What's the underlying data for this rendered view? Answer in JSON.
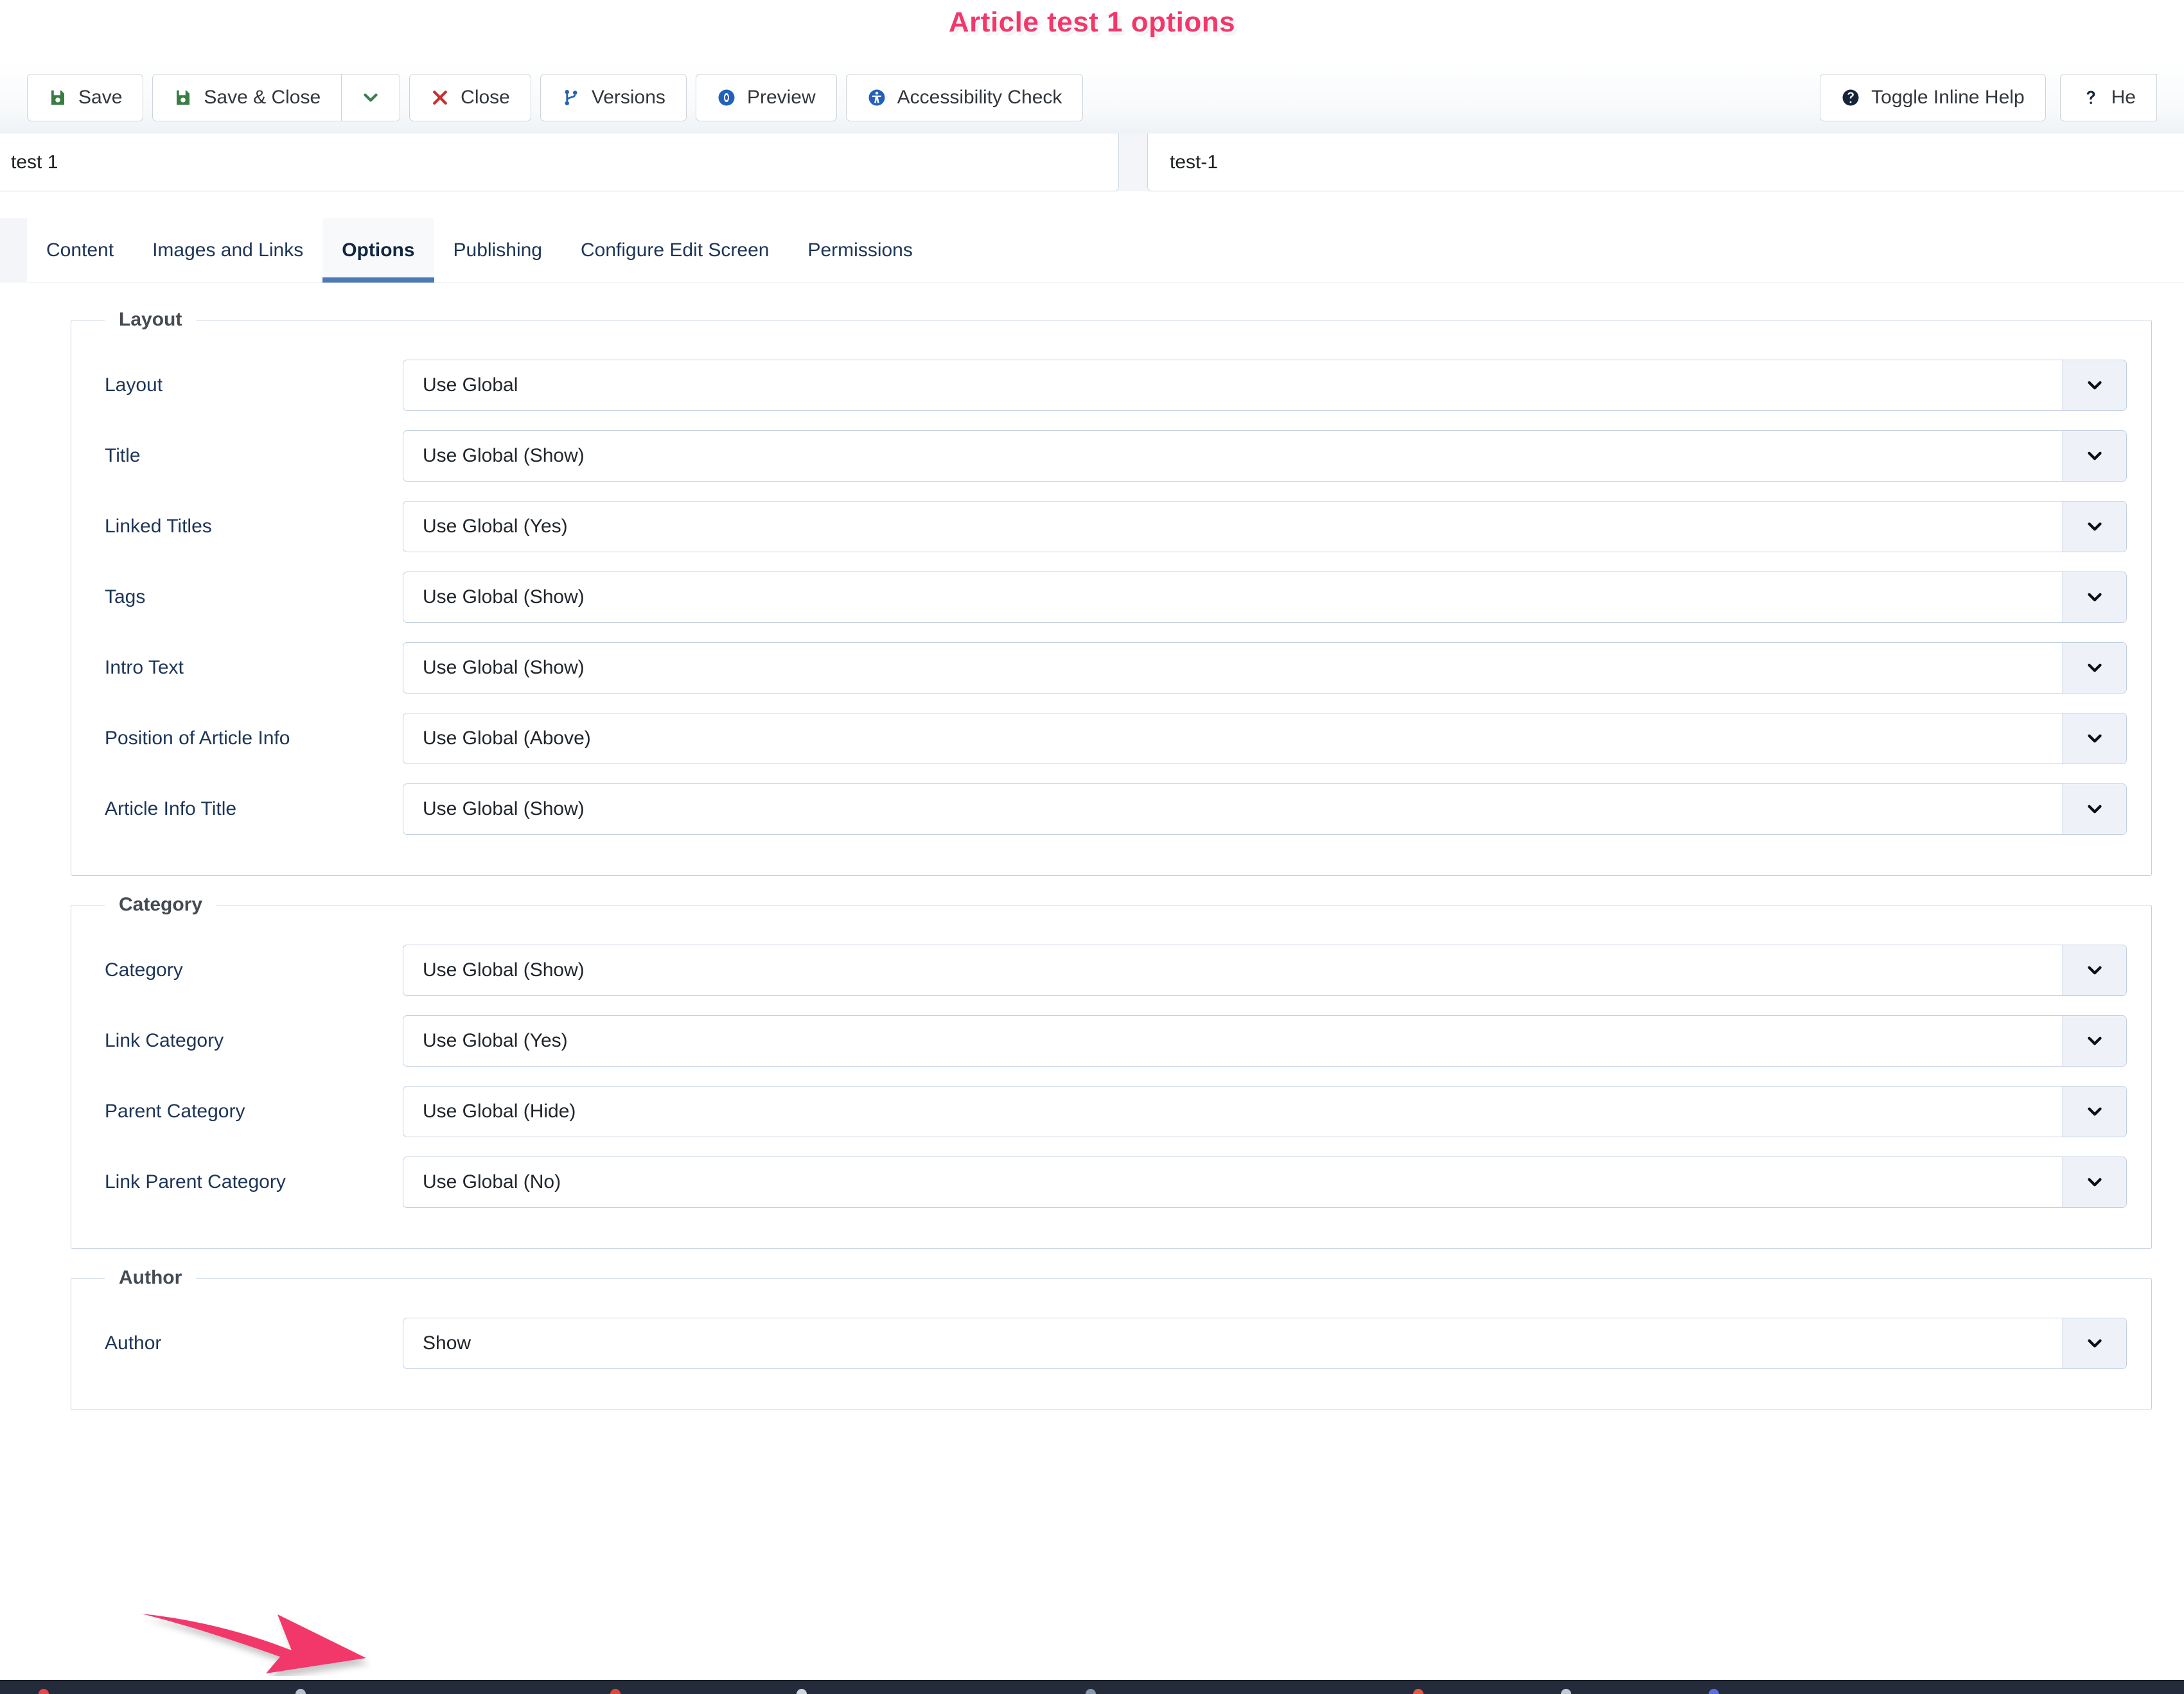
{
  "annotation": {
    "title": "Article test 1 options",
    "title_color": "#f2376b",
    "arrow_color": "#f2376b"
  },
  "toolbar": {
    "left_buttons": [
      {
        "label": "Save",
        "icon": "save-icon",
        "icon_color": "#3a7d44"
      },
      {
        "label": "Save & Close",
        "icon": "save-icon",
        "icon_color": "#3a7d44",
        "has_caret": true,
        "caret_color": "#3f7d4e"
      },
      {
        "label": "Close",
        "icon": "close-x-icon",
        "icon_color": "#c9302c"
      },
      {
        "label": "Versions",
        "icon": "versions-branch-icon",
        "icon_color": "#2360b8"
      },
      {
        "label": "Preview",
        "icon": "preview-eye-icon",
        "icon_color": "#2360b8"
      },
      {
        "label": "Accessibility Check",
        "icon": "accessibility-icon",
        "icon_color": "#2360b8"
      }
    ],
    "right_buttons": [
      {
        "label": "Toggle Inline Help",
        "icon": "question-circle-icon",
        "icon_color": "#16243a"
      },
      {
        "label": "He",
        "icon": "question-mark-icon",
        "icon_color": "#16243a"
      }
    ]
  },
  "fields": {
    "title": {
      "value": "test 1"
    },
    "alias": {
      "value": "test-1"
    }
  },
  "tabs": [
    {
      "label": "Content",
      "active": false
    },
    {
      "label": "Images and Links",
      "active": false
    },
    {
      "label": "Options",
      "active": true
    },
    {
      "label": "Publishing",
      "active": false
    },
    {
      "label": "Configure Edit Screen",
      "active": false
    },
    {
      "label": "Permissions",
      "active": false
    }
  ],
  "groups": [
    {
      "legend": "Layout",
      "rows": [
        {
          "label": "Layout",
          "value": "Use Global"
        },
        {
          "label": "Title",
          "value": "Use Global (Show)"
        },
        {
          "label": "Linked Titles",
          "value": "Use Global (Yes)"
        },
        {
          "label": "Tags",
          "value": "Use Global (Show)"
        },
        {
          "label": "Intro Text",
          "value": "Use Global (Show)"
        },
        {
          "label": "Position of Article Info",
          "value": "Use Global (Above)"
        },
        {
          "label": "Article Info Title",
          "value": "Use Global (Show)"
        }
      ]
    },
    {
      "legend": "Category",
      "rows": [
        {
          "label": "Category",
          "value": "Use Global (Show)"
        },
        {
          "label": "Link Category",
          "value": "Use Global (Yes)"
        },
        {
          "label": "Parent Category",
          "value": "Use Global (Hide)"
        },
        {
          "label": "Link Parent Category",
          "value": "Use Global (No)"
        }
      ]
    },
    {
      "legend": "Author",
      "rows": [
        {
          "label": "Author",
          "value": "Show"
        }
      ]
    }
  ]
}
